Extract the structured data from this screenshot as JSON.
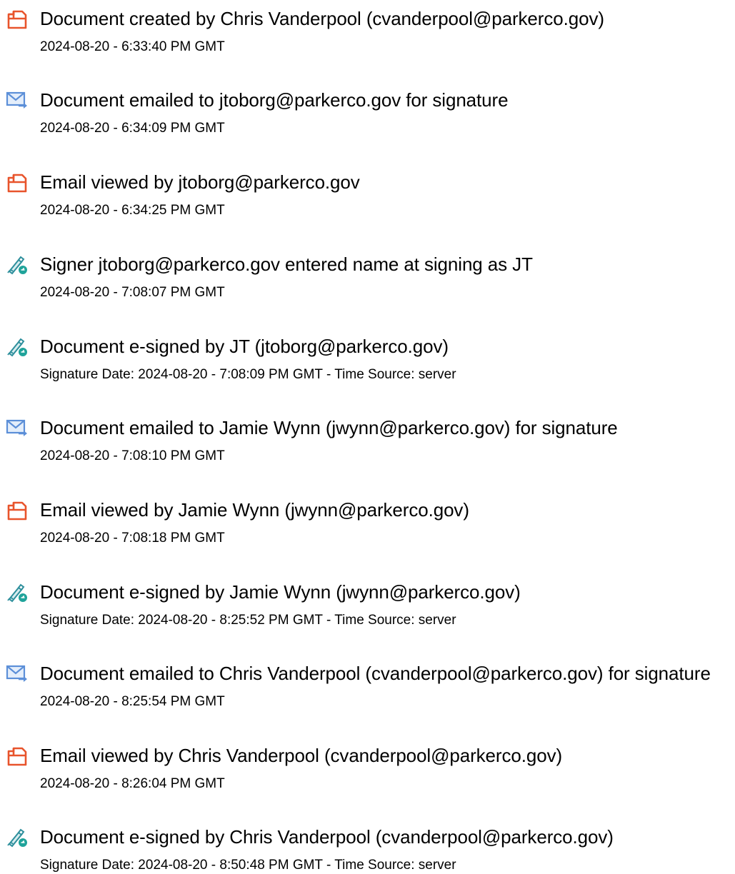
{
  "colors": {
    "doc_icon": "#e8542c",
    "mail_icon": "#5c8fd8",
    "sign_icon": "#2e8f9c",
    "sign_badge": "#1fa39a",
    "text": "#000000"
  },
  "events": [
    {
      "icon": "document-icon",
      "title": "Document created by Chris Vanderpool (cvanderpool@parkerco.gov)",
      "detail": "2024-08-20 - 6:33:40 PM GMT"
    },
    {
      "icon": "email-sent-icon",
      "title": "Document emailed to jtoborg@parkerco.gov for signature",
      "detail": "2024-08-20 - 6:34:09 PM GMT"
    },
    {
      "icon": "document-icon",
      "title": "Email viewed by jtoborg@parkerco.gov",
      "detail": "2024-08-20 - 6:34:25 PM GMT"
    },
    {
      "icon": "signature-pen-icon",
      "title": "Signer jtoborg@parkerco.gov entered name at signing as JT",
      "detail": "2024-08-20 - 7:08:07 PM GMT"
    },
    {
      "icon": "signature-pen-icon",
      "title": "Document e-signed by JT (jtoborg@parkerco.gov)",
      "detail": "Signature Date: 2024-08-20 - 7:08:09 PM GMT - Time Source: server"
    },
    {
      "icon": "email-sent-icon",
      "title": "Document emailed to Jamie Wynn (jwynn@parkerco.gov) for signature",
      "detail": "2024-08-20 - 7:08:10 PM GMT"
    },
    {
      "icon": "document-icon",
      "title": "Email viewed by Jamie Wynn (jwynn@parkerco.gov)",
      "detail": "2024-08-20 - 7:08:18 PM GMT"
    },
    {
      "icon": "signature-pen-icon",
      "title": "Document e-signed by Jamie Wynn (jwynn@parkerco.gov)",
      "detail": "Signature Date: 2024-08-20 - 8:25:52 PM GMT - Time Source: server"
    },
    {
      "icon": "email-sent-icon",
      "title": "Document emailed to Chris Vanderpool (cvanderpool@parkerco.gov) for signature",
      "detail": "2024-08-20 - 8:25:54 PM GMT"
    },
    {
      "icon": "document-icon",
      "title": "Email viewed by Chris Vanderpool (cvanderpool@parkerco.gov)",
      "detail": "2024-08-20 - 8:26:04 PM GMT"
    },
    {
      "icon": "signature-pen-icon",
      "title": "Document e-signed by Chris Vanderpool (cvanderpool@parkerco.gov)",
      "detail": "Signature Date: 2024-08-20 - 8:50:48 PM GMT - Time Source: server"
    }
  ]
}
